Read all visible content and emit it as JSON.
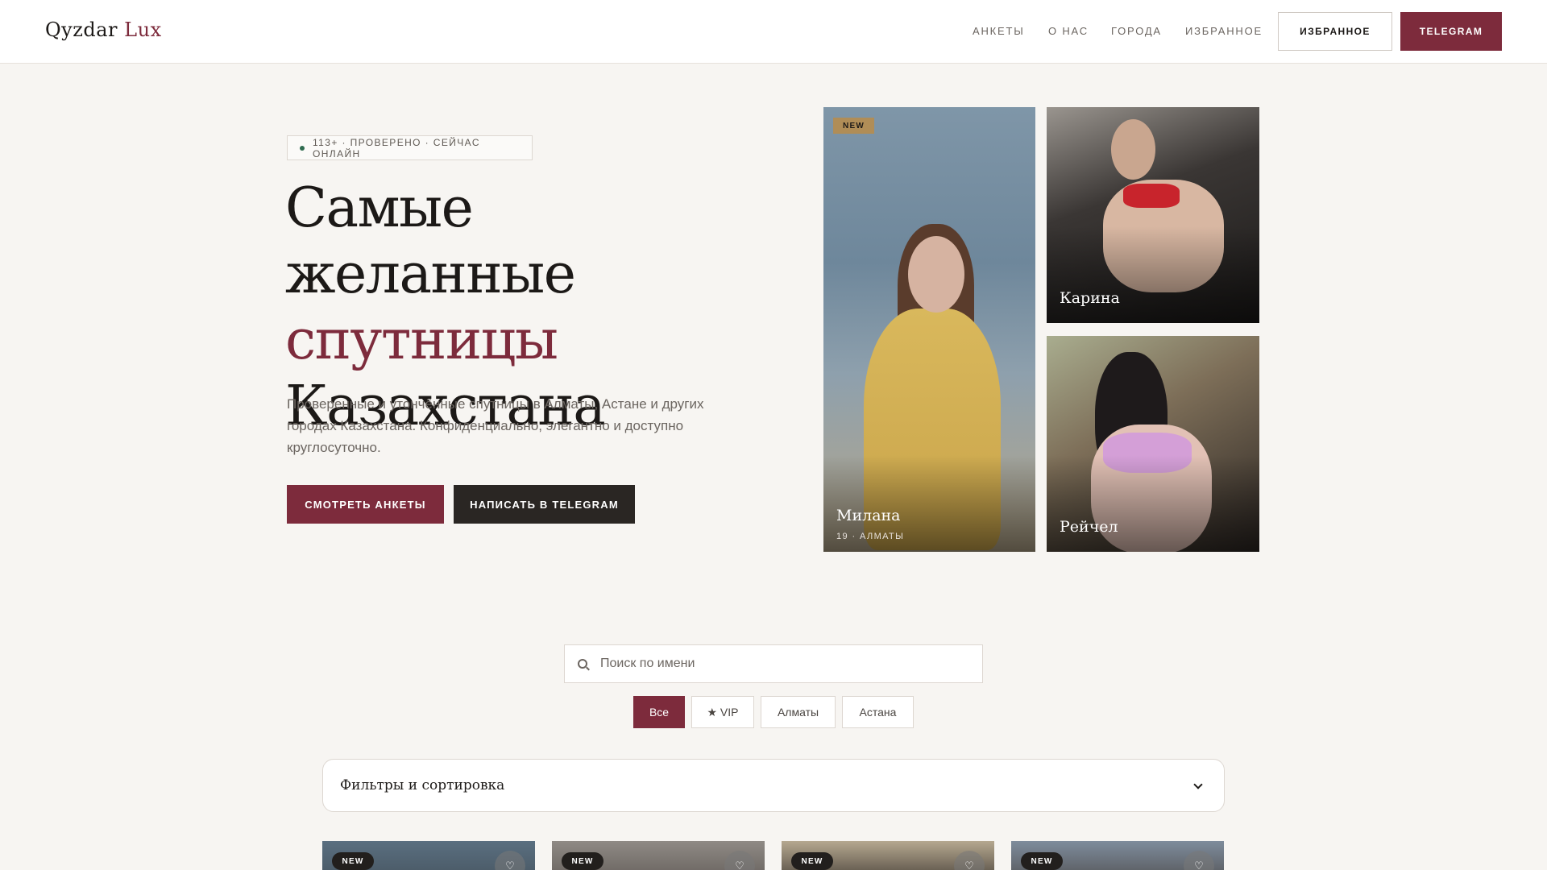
{
  "header": {
    "logo_main": "Qyzdar",
    "logo_accent": "Lux",
    "nav": [
      "АНКЕТЫ",
      "О НАС",
      "ГОРОДА",
      "ИЗБРАННОЕ"
    ],
    "favorites_button": "ИЗБРАННОЕ",
    "telegram_button": "TELEGRAM"
  },
  "hero": {
    "badge": "113+ · ПРОВЕРЕНО · СЕЙЧАС ОНЛАЙН",
    "title_line1": "Самые желанные",
    "title_accent": "спутницы",
    "title_line3": "Казахстана",
    "subtitle": "Проверенные и утончённые спутницы в Алматы, Астане и других городах Казахстана. Конфиденциально, элегантно и доступно круглосуточно.",
    "cta_primary": "СМОТРЕТЬ АНКЕТЫ",
    "cta_secondary": "НАПИСАТЬ В TELEGRAM"
  },
  "featured": [
    {
      "name": "Милана",
      "meta": "19 · АЛМАТЫ",
      "tag": "NEW"
    },
    {
      "name": "Карина"
    },
    {
      "name": "Рейчел"
    }
  ],
  "search": {
    "placeholder": "Поиск по имени",
    "value": ""
  },
  "chips": [
    {
      "label": "Все",
      "active": true
    },
    {
      "label": "★ VIP",
      "active": false
    },
    {
      "label": "Алматы",
      "active": false
    },
    {
      "label": "Астана",
      "active": false
    }
  ],
  "filters": {
    "label": "Фильтры и сортировка"
  },
  "cards": [
    {
      "tag": "NEW"
    },
    {
      "tag": "NEW"
    },
    {
      "tag": "NEW"
    },
    {
      "tag": "NEW"
    }
  ],
  "colors": {
    "accent": "#7d2b3c",
    "background": "#f7f5f2",
    "dark_button": "#2a2623",
    "gold_tag": "#b08d57",
    "online_dot": "#2f6b4f"
  },
  "icons": {
    "search": "search-icon",
    "chevron": "chevron-down-icon",
    "heart": "heart-icon",
    "star": "star-icon"
  }
}
